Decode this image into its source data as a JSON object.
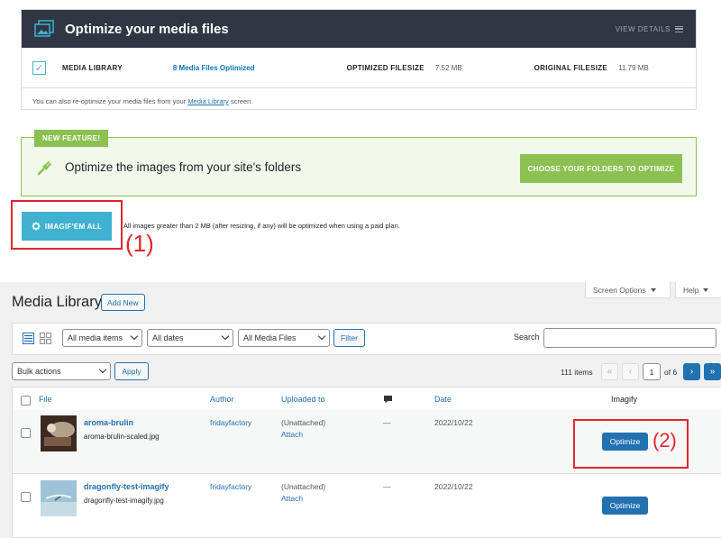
{
  "imagify": {
    "title": "Optimize your media files",
    "view_details": "VIEW DETAILS",
    "media_library_label": "MEDIA LIBRARY",
    "optimized_link": "8 Media Files Optimized",
    "optimized_filesize_label": "OPTIMIZED FILESIZE",
    "optimized_filesize_value": "7.52 MB",
    "original_filesize_label": "ORIGINAL FILESIZE",
    "original_filesize_value": "11.79 MB",
    "reopt_before": "You can also re-optimize your media files from your",
    "reopt_link": "Media Library",
    "reopt_after": "screen."
  },
  "new_feature": {
    "badge": "NEW FEATURE!",
    "text": "Optimize the images from your site's folders",
    "button": "CHOOSE YOUR FOLDERS TO OPTIMIZE"
  },
  "imagify_all": {
    "button": "IMAGIF'EM ALL",
    "note": "All images greater than 2 MB (after resizing, if any) will be optimized when using a paid plan.",
    "mark": "(1)"
  },
  "screen_tabs": {
    "screen_options": "Screen Options",
    "help": "Help"
  },
  "media_library": {
    "title": "Media Library",
    "add_new": "Add New",
    "filters": {
      "media_type": "All media items",
      "dates": "All dates",
      "media_files": "All Media Files",
      "filter_button": "Filter"
    },
    "search_label": "Search",
    "bulk_actions": "Bulk actions",
    "apply": "Apply",
    "pagination": {
      "items": "111 items",
      "first": "«",
      "prev": "‹",
      "current": "1",
      "of": "of 6",
      "next": "›",
      "last": "»"
    },
    "columns": {
      "file": "File",
      "author": "Author",
      "uploaded_to": "Uploaded to",
      "date": "Date",
      "imagify": "Imagify"
    },
    "rows": [
      {
        "title": "aroma-brulin",
        "filename": "aroma-brulin-scaled.jpg",
        "author": "fridayfactory",
        "uploaded": "(Unattached)",
        "attach": "Attach",
        "comments": "—",
        "date": "2022/10/22",
        "action": "Optimize"
      },
      {
        "title": "dragonfly-test-imagify",
        "filename": "dragonfly-test-imagify.jpg",
        "author": "fridayfactory",
        "uploaded": "(Unattached)",
        "attach": "Attach",
        "comments": "—",
        "date": "2022/10/22",
        "action": "Optimize"
      }
    ],
    "mark": "(2)"
  }
}
